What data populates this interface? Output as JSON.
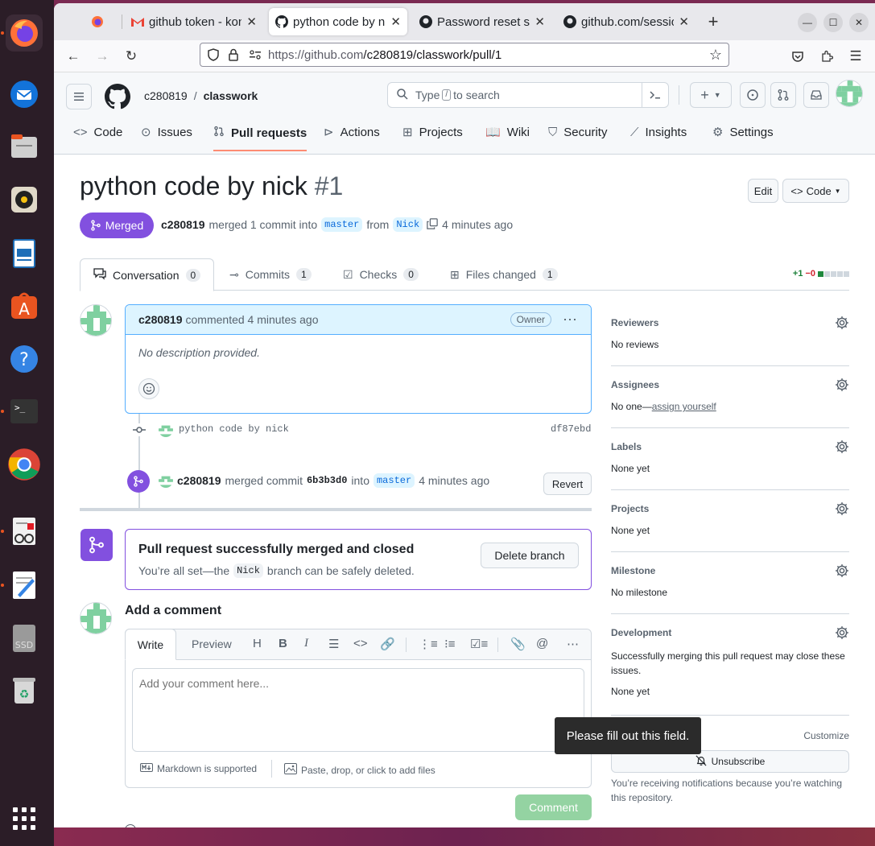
{
  "browser": {
    "tabs": [
      {
        "label": "",
        "icon": "firefox-icon"
      },
      {
        "label": "github token - kon",
        "icon": "gmail-icon"
      },
      {
        "label": "python code by nic",
        "icon": "github-icon",
        "active": true
      },
      {
        "label": "Password reset se",
        "icon": "github-icon"
      },
      {
        "label": "github.com/sessio",
        "icon": "github-icon"
      }
    ],
    "url_host": "https://github.com",
    "url_path": "/c280819/classwork/pull/1"
  },
  "gh": {
    "owner": "c280819",
    "slash": "/",
    "repo": "classwork",
    "search_pre": "Type",
    "search_key": "/",
    "search_post": "to search",
    "nav": [
      "Code",
      "Issues",
      "Pull requests",
      "Actions",
      "Projects",
      "Wiki",
      "Security",
      "Insights",
      "Settings"
    ]
  },
  "pr": {
    "title": "python code by nick",
    "number": "#1",
    "edit_label": "Edit",
    "code_label": "Code",
    "status": "Merged",
    "author": "c280819",
    "merged_text": "merged 1 commit into",
    "base": "master",
    "from_text": "from",
    "head": "Nick",
    "time": "4 minutes ago",
    "tabs": [
      {
        "label": "Conversation",
        "count": "0"
      },
      {
        "label": "Commits",
        "count": "1"
      },
      {
        "label": "Checks",
        "count": "0"
      },
      {
        "label": "Files changed",
        "count": "1"
      }
    ],
    "diff_add": "+1",
    "diff_del": "−0"
  },
  "comment": {
    "author": "c280819",
    "action": "commented 4 minutes ago",
    "badge": "Owner",
    "body": "No description provided."
  },
  "commit": {
    "message": "python code by nick",
    "sha": "df87ebd"
  },
  "merge_event": {
    "author": "c280819",
    "text1": "merged commit",
    "sha": "6b3b3d0",
    "text2": "into",
    "base": "master",
    "time": "4 minutes ago",
    "revert_label": "Revert"
  },
  "merged_box": {
    "title": "Pull request successfully merged and closed",
    "text1": "You’re all set—the",
    "branch": "Nick",
    "text2": "branch can be safely deleted.",
    "delete_label": "Delete branch"
  },
  "add_comment": {
    "heading": "Add a comment",
    "write_tab": "Write",
    "preview_tab": "Preview",
    "placeholder": "Add your comment here...",
    "markdown_note": "Markdown is supported",
    "attach_note": "Paste, drop, or click to add files",
    "submit_label": "Comment"
  },
  "sidebar": {
    "reviewers": {
      "title": "Reviewers",
      "value": "No reviews"
    },
    "assignees": {
      "title": "Assignees",
      "value": "No one—",
      "link": "assign yourself"
    },
    "labels": {
      "title": "Labels",
      "value": "None yet"
    },
    "projects": {
      "title": "Projects",
      "value": "None yet"
    },
    "milestone": {
      "title": "Milestone",
      "value": "No milestone"
    },
    "development": {
      "title": "Development",
      "desc": "Successfully merging this pull request may close these issues.",
      "value": "None yet"
    },
    "notifications": {
      "customize": "Customize",
      "unsubscribe": "Unsubscribe",
      "note": "You’re receiving notifications because you’re watching this repository."
    }
  },
  "tooltip": "Please fill out this field."
}
